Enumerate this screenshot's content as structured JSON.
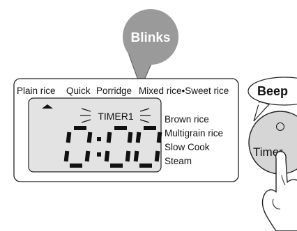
{
  "callout": {
    "label": "Blinks"
  },
  "control_panel": {
    "menu_top": {
      "plain_rice": "Plain rice",
      "quick": "Quick",
      "porridge": "Porridge",
      "mixed_sweet": "Mixed rice•Sweet rice"
    },
    "display": {
      "timer_label": "TIMER1",
      "time": "0:00"
    },
    "menu_side": [
      "Brown rice",
      "Multigrain rice",
      "Slow Cook",
      "Steam"
    ]
  },
  "speech": {
    "beep": "Beep"
  },
  "timer_button": {
    "label": "Timer"
  },
  "colors": {
    "callout_fill": "#9a9a9a",
    "display_fill": "#e3e3e3",
    "button_fill": "#d6d6d6",
    "outline": "#222222"
  }
}
